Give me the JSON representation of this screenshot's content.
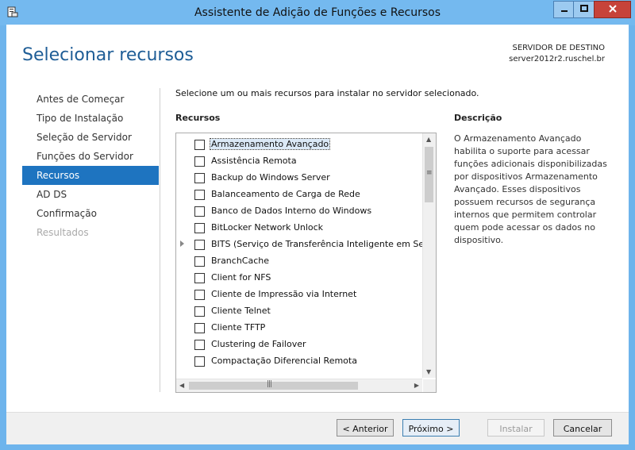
{
  "window": {
    "title": "Assistente de Adição de Funções e Recursos"
  },
  "header": {
    "page_title": "Selecionar recursos",
    "destination_label": "SERVIDOR DE DESTINO",
    "destination_server": "server2012r2.ruschel.br"
  },
  "nav": {
    "items": [
      {
        "label": "Antes de Começar",
        "state": "normal"
      },
      {
        "label": "Tipo de Instalação",
        "state": "normal"
      },
      {
        "label": "Seleção de Servidor",
        "state": "normal"
      },
      {
        "label": "Funções do Servidor",
        "state": "normal"
      },
      {
        "label": "Recursos",
        "state": "active"
      },
      {
        "label": "AD DS",
        "state": "normal"
      },
      {
        "label": "Confirmação",
        "state": "normal"
      },
      {
        "label": "Resultados",
        "state": "disabled"
      }
    ]
  },
  "main": {
    "instruction": "Selecione um ou mais recursos para instalar no servidor selecionado.",
    "features_header": "Recursos",
    "description_header": "Descrição",
    "description_text": "O Armazenamento Avançado habilita o suporte para acessar funções adicionais disponibilizadas por dispositivos Armazenamento Avançado. Esses dispositivos possuem recursos de segurança internos que permitem controlar quem pode acessar os dados no dispositivo.",
    "features": [
      {
        "label": "Armazenamento Avançado",
        "checked": false,
        "selected": true,
        "expandable": false
      },
      {
        "label": "Assistência Remota",
        "checked": false,
        "selected": false,
        "expandable": false
      },
      {
        "label": "Backup do Windows Server",
        "checked": false,
        "selected": false,
        "expandable": false
      },
      {
        "label": "Balanceamento de Carga de Rede",
        "checked": false,
        "selected": false,
        "expandable": false
      },
      {
        "label": "Banco de Dados Interno do Windows",
        "checked": false,
        "selected": false,
        "expandable": false
      },
      {
        "label": "BitLocker Network Unlock",
        "checked": false,
        "selected": false,
        "expandable": false
      },
      {
        "label": "BITS (Serviço de Transferência Inteligente em Segu",
        "checked": false,
        "selected": false,
        "expandable": true
      },
      {
        "label": "BranchCache",
        "checked": false,
        "selected": false,
        "expandable": false
      },
      {
        "label": "Client for NFS",
        "checked": false,
        "selected": false,
        "expandable": false
      },
      {
        "label": "Cliente de Impressão via Internet",
        "checked": false,
        "selected": false,
        "expandable": false
      },
      {
        "label": "Cliente Telnet",
        "checked": false,
        "selected": false,
        "expandable": false
      },
      {
        "label": "Cliente TFTP",
        "checked": false,
        "selected": false,
        "expandable": false
      },
      {
        "label": "Clustering de Failover",
        "checked": false,
        "selected": false,
        "expandable": false
      },
      {
        "label": "Compactação Diferencial Remota",
        "checked": false,
        "selected": false,
        "expandable": false
      }
    ]
  },
  "footer": {
    "back_label": "< Anterior",
    "next_label": "Próximo >",
    "install_label": "Instalar",
    "cancel_label": "Cancelar"
  },
  "colors": {
    "accent": "#1e74c0",
    "title_blue": "#1e5d96",
    "window_frame": "#74b9ef",
    "close_button": "#c7433a"
  }
}
